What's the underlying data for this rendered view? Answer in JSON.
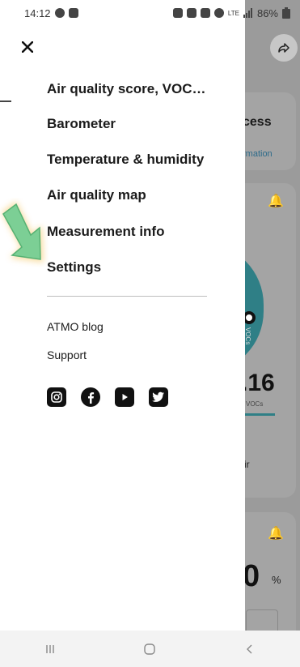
{
  "status_bar": {
    "time": "14:12",
    "battery": "86%",
    "network": "LTE"
  },
  "drawer": {
    "menu_items": [
      "Air quality score, VOC…",
      "Barometer",
      "Temperature & humidity",
      "Air quality map",
      "Measurement info",
      "Settings"
    ],
    "links": [
      "ATMO blog",
      "Support"
    ],
    "social_icons": [
      "instagram-icon",
      "facebook-icon",
      "youtube-icon",
      "twitter-icon"
    ]
  },
  "background": {
    "card1_title": "cess",
    "card1_link": "rmation",
    "value_vocs": ".16",
    "vocs_label": "VOCs",
    "air_label": "ir",
    "gauge_label": "VOCs",
    "value_humidity": "0",
    "humidity_unit": "%"
  },
  "colors": {
    "accent_teal": "#2f7f86",
    "arrow_green": "#7ccf95",
    "arrow_glow": "#f3c25a"
  }
}
